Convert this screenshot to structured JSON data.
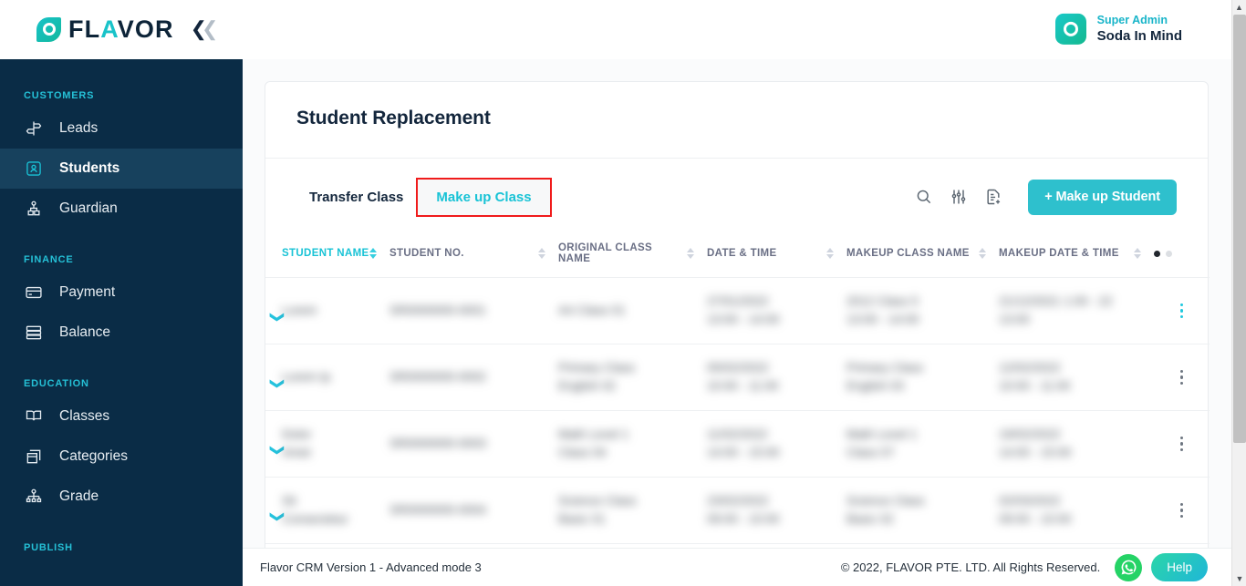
{
  "header": {
    "brand_text_1": "FL",
    "brand_text_v": "A",
    "brand_text_2": "VOR",
    "collapse_icon": "double-chevron-left-icon",
    "user_role": "Super Admin",
    "user_name": "Soda In Mind"
  },
  "sidebar": {
    "sections": [
      {
        "label": "CUSTOMERS",
        "items": [
          {
            "label": "Leads",
            "icon": "signpost-icon",
            "active": false
          },
          {
            "label": "Students",
            "icon": "student-badge-icon",
            "active": true
          },
          {
            "label": "Guardian",
            "icon": "guardian-icon",
            "active": false
          }
        ]
      },
      {
        "label": "FINANCE",
        "items": [
          {
            "label": "Payment",
            "icon": "credit-card-icon",
            "active": false
          },
          {
            "label": "Balance",
            "icon": "database-icon",
            "active": false
          }
        ]
      },
      {
        "label": "EDUCATION",
        "items": [
          {
            "label": "Classes",
            "icon": "open-book-icon",
            "active": false
          },
          {
            "label": "Categories",
            "icon": "box-stack-icon",
            "active": false
          },
          {
            "label": "Grade",
            "icon": "org-chart-icon",
            "active": false
          }
        ]
      },
      {
        "label": "PUBLISH",
        "items": []
      }
    ]
  },
  "page": {
    "title": "Student Replacement",
    "tabs": [
      {
        "label": "Transfer Class",
        "selected": false
      },
      {
        "label": "Make up Class",
        "selected": true
      }
    ],
    "toolbar": {
      "search_icon": "search-icon",
      "filter_icon": "sliders-filter-icon",
      "export_icon": "document-add-icon",
      "primary_button": "+ Make up Student"
    },
    "highlight_color": "#f01b1b",
    "accent_color": "#19c3d6"
  },
  "table": {
    "columns": [
      {
        "label": "STUDENT NAME",
        "sorted": true
      },
      {
        "label": "STUDENT NO.",
        "sorted": false
      },
      {
        "label": "ORIGINAL CLASS NAME",
        "sorted": false
      },
      {
        "label": "DATE & TIME",
        "sorted": false
      },
      {
        "label": "MAKEUP CLASS NAME",
        "sorted": false
      },
      {
        "label": "MAKEUP DATE & TIME",
        "sorted": false
      }
    ],
    "page_dots": {
      "total": 2,
      "active_index": 0
    },
    "rows": [
      {
        "expand_icon": "chevron-down-icon",
        "student_name": "Lorem",
        "student_no": "SR0000000-0001",
        "original_class_name": "Art Class 01",
        "date_time": "27/01/2022\n13:00 - 14:00",
        "makeup_class_name": "2012 Class 5\n13:00 - 14:00",
        "makeup_date_time": "21/12/2021 1:00 - 22\n13:00",
        "menu_icon": "kebab-menu-icon",
        "menu_active": true
      },
      {
        "expand_icon": "chevron-down-icon",
        "student_name": "Lorem Ip",
        "student_no": "SR0000000-0002",
        "original_class_name": "Primary Class\nEnglish 02",
        "date_time": "05/02/2022\n10:00 - 11:00",
        "makeup_class_name": "Primary Class\nEnglish 03",
        "makeup_date_time": "12/02/2022\n10:00 - 11:00",
        "menu_icon": "kebab-menu-icon",
        "menu_active": false
      },
      {
        "expand_icon": "chevron-down-icon",
        "student_name": "Dolor\nAmet",
        "student_no": "SR0000000-0003",
        "original_class_name": "Math Level 1\nClass 04",
        "date_time": "11/02/2022\n14:00 - 15:00",
        "makeup_class_name": "Math Level 1\nClass 07",
        "makeup_date_time": "19/02/2022\n14:00 - 15:00",
        "menu_icon": "kebab-menu-icon",
        "menu_active": false
      },
      {
        "expand_icon": "chevron-down-icon",
        "student_name": "Sit\nConsectetur",
        "student_no": "SR0000000-0004",
        "original_class_name": "Science Class\nBasic 01",
        "date_time": "23/02/2022\n09:00 - 10:00",
        "makeup_class_name": "Science Class\nBasic 02",
        "makeup_date_time": "02/03/2022\n09:00 - 10:00",
        "menu_icon": "kebab-menu-icon",
        "menu_active": false
      }
    ]
  },
  "footer": {
    "left": "Flavor CRM Version 1 - Advanced mode 3",
    "right": "© 2022, FLAVOR PTE. LTD. All Rights Reserved.",
    "whatsapp_icon": "whatsapp-icon",
    "help_label": "Help"
  },
  "scrollbar": {
    "up_arrow": "chevron-up-icon",
    "down_arrow": "chevron-down-icon"
  }
}
